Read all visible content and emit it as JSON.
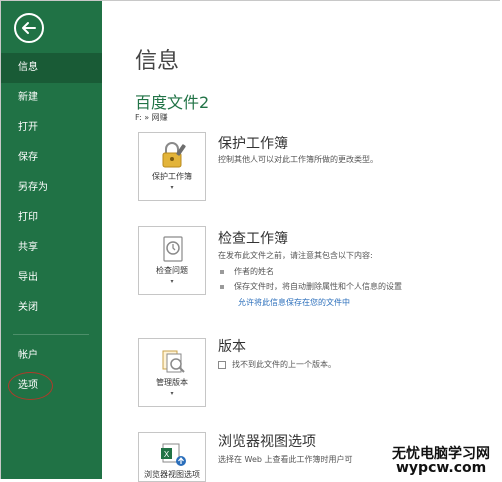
{
  "colors": {
    "sidebar_bg": "#207245",
    "sidebar_active": "#195b36",
    "accent_green": "#217346",
    "link_blue": "#2a6ebb",
    "annotation_red": "#b03a2a"
  },
  "sidebar": {
    "back_icon": "back-arrow-icon",
    "items": [
      {
        "label": "信息",
        "active": true
      },
      {
        "label": "新建"
      },
      {
        "label": "打开"
      },
      {
        "label": "保存"
      },
      {
        "label": "另存为"
      },
      {
        "label": "打印"
      },
      {
        "label": "共享"
      },
      {
        "label": "导出"
      },
      {
        "label": "关闭"
      }
    ],
    "bottom_items": [
      {
        "label": "帐户"
      },
      {
        "label": "选项",
        "annotated": true
      }
    ]
  },
  "main": {
    "title": "信息",
    "doc_name": "百度文件2",
    "doc_path": "F: » 网赚",
    "sections": [
      {
        "tile_label": "保护工作簿",
        "tile_icon": "lock-key-icon",
        "title": "保护工作簿",
        "desc": "控制其他人可以对此工作簿所做的更改类型。"
      },
      {
        "tile_label": "检查问题",
        "tile_icon": "inspect-document-icon",
        "title": "检查工作簿",
        "desc": "在发布此文件之前，请注意其包含以下内容:",
        "bullets": [
          "作者的姓名",
          "保存文件时，将自动删除属性和个人信息的设置"
        ],
        "link": "允许将此信息保存在您的文件中"
      },
      {
        "tile_label": "管理版本",
        "tile_icon": "manage-versions-icon",
        "title": "版本",
        "desc": "找不到此文件的上一个版本。"
      },
      {
        "tile_label": "浏览器视图选项",
        "tile_icon": "excel-browser-icon",
        "title": "浏览器视图选项",
        "desc": "选择在 Web 上查看此工作簿时用户可"
      }
    ]
  },
  "watermark": {
    "line1": "无忧电脑学习网",
    "line2": "wypcw.com"
  }
}
